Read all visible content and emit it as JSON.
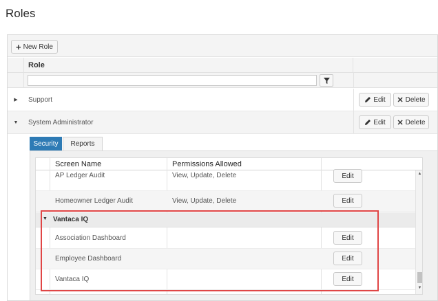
{
  "page": {
    "title": "Roles"
  },
  "toolbar": {
    "new_role_label": "New Role",
    "new_role_icon": "plus-icon"
  },
  "roles_grid": {
    "column_header": "Role",
    "filter_value": "",
    "filter_icon": "filter-icon",
    "edit_label": "Edit",
    "delete_label": "Delete",
    "rows": [
      {
        "name": "Support",
        "expanded": false
      },
      {
        "name": "System Administrator",
        "expanded": true
      }
    ]
  },
  "detail": {
    "tabs": [
      {
        "label": "Security",
        "active": true
      },
      {
        "label": "Reports",
        "active": false
      }
    ],
    "permissions": {
      "columns": [
        "Screen Name",
        "Permissions Allowed"
      ],
      "edit_label": "Edit",
      "rows": [
        {
          "screen": "AP Ledger Audit",
          "permissions": "View, Update, Delete"
        },
        {
          "screen": "Homeowner Ledger Audit",
          "permissions": "View, Update, Delete"
        }
      ],
      "group": {
        "name": "Vantaca IQ",
        "rows": [
          {
            "screen": "Association Dashboard",
            "permissions": ""
          },
          {
            "screen": "Employee Dashboard",
            "permissions": ""
          },
          {
            "screen": "Vantaca IQ",
            "permissions": ""
          }
        ]
      }
    }
  },
  "colors": {
    "accent": "#2e7bb5",
    "highlight": "#e04545"
  }
}
